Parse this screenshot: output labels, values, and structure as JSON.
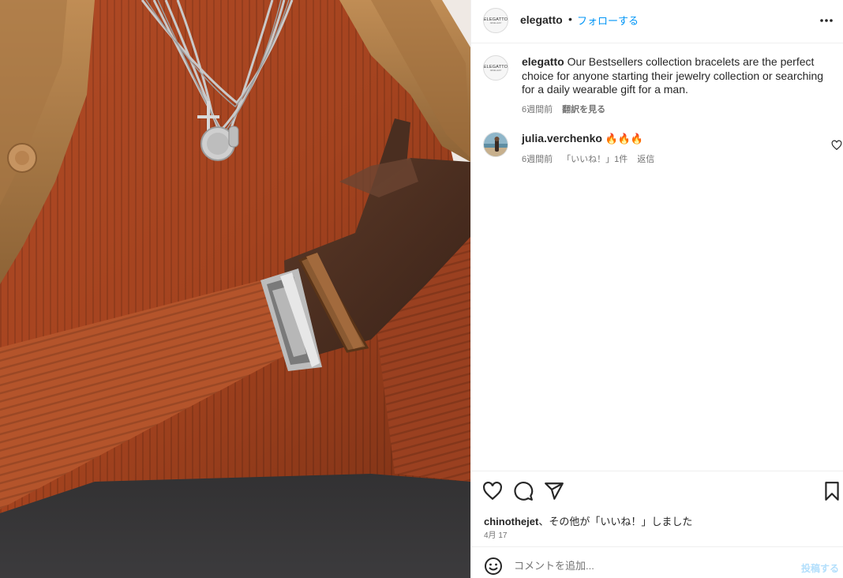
{
  "post": {
    "account": {
      "username": "elegatto",
      "separator": "•",
      "follow_label": "フォローする",
      "logo_text": "ELEGATTO",
      "logo_subtext": "JEWELLERY"
    }
  },
  "caption": {
    "username": "elegatto",
    "text": " Our Bestsellers collection bracelets are the perfect choice for anyone starting their jewelry collection or searching for a daily wearable gift for a man.",
    "time": "6週間前",
    "translate_label": "翻訳を見る"
  },
  "comments": [
    {
      "username": "julia.verchenko",
      "text": " 🔥🔥🔥",
      "time": "6週間前",
      "likes": "「いいね！」1件",
      "reply_label": "返信"
    }
  ],
  "actions": {
    "likes_user": "chinothejet",
    "likes_suffix": "、その他が「いいね！」しました",
    "date": "4月 17"
  },
  "composer": {
    "placeholder": "コメントを追加...",
    "post_label": "投稿する"
  },
  "icons": {
    "more": "more-horizontal-icon",
    "like": "heart-icon",
    "comment": "comment-bubble-icon",
    "share": "paper-plane-icon",
    "save": "bookmark-icon",
    "emoji": "smiley-icon"
  },
  "colors": {
    "link_blue": "#0095f6",
    "post_disabled": "#b3dffc",
    "text_primary": "#262626",
    "text_secondary": "#737373",
    "divider": "#efefef"
  }
}
